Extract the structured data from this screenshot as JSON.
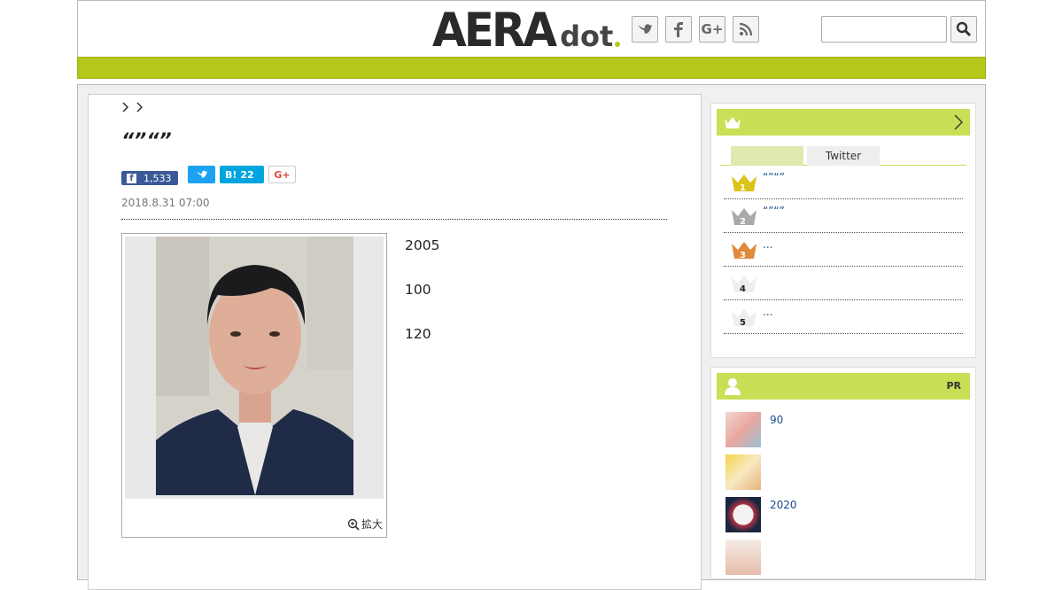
{
  "header": {
    "logo_main": "AERA",
    "logo_sub": "dot",
    "search_placeholder": ""
  },
  "colors": {
    "accent": "#b3c81a",
    "panel_head": "#c9df55",
    "link": "#1a4c8c"
  },
  "article": {
    "title": "“”“”",
    "share": {
      "facebook_count": "1,533",
      "hatena_label": "B!",
      "hatena_count": "22"
    },
    "date": "2018.8.31 07:00",
    "photo_zoom_label": "拡大",
    "paragraphs": [
      "2005",
      "100",
      "",
      "120"
    ]
  },
  "sidebar": {
    "ranking": {
      "tabs": [
        "",
        "Twitter"
      ],
      "items": [
        {
          "rank": "1",
          "text": "“”“”"
        },
        {
          "rank": "2",
          "text": "“”“”"
        },
        {
          "rank": "3",
          "text": "..."
        },
        {
          "rank": "4",
          "text": ""
        },
        {
          "rank": "5",
          "text": "..."
        }
      ]
    },
    "pr": {
      "badge": "PR",
      "items": [
        {
          "text": "90"
        },
        {
          "text": ""
        },
        {
          "text": "2020"
        },
        {
          "text": ""
        }
      ]
    }
  }
}
